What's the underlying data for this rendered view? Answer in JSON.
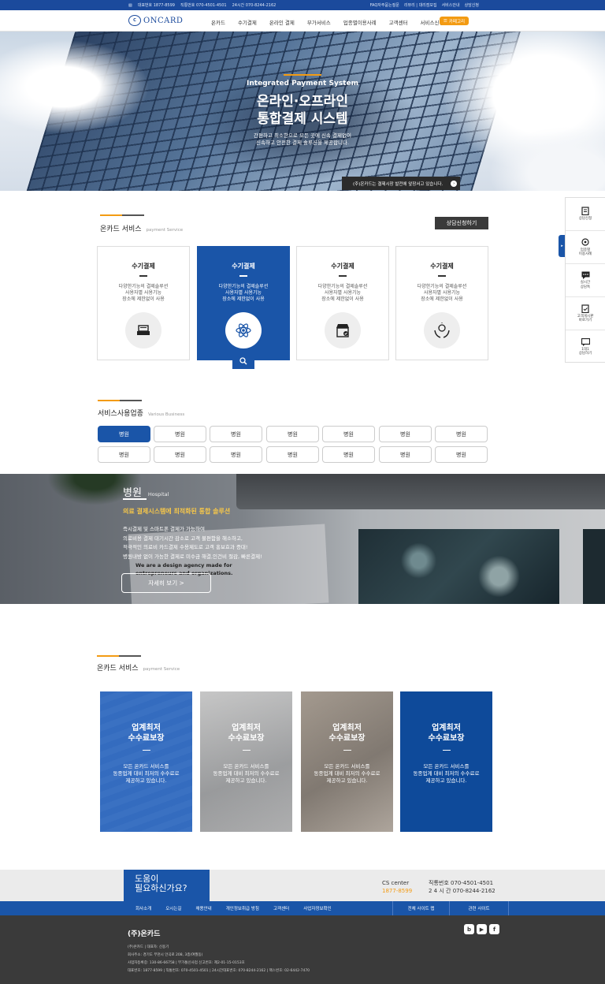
{
  "topbar": {
    "rep_phone": "대표번호 1877-8599",
    "direct_phone": "직통번호 070-4501-4501",
    "hours_phone": "24시간 070-8244-2162",
    "links": [
      "FAQ자주묻는질문",
      "리뷰리 | 대리점모집",
      "서비스안내",
      "상담신청"
    ]
  },
  "header": {
    "logo_text": "ONCARD",
    "nav": [
      "온카드",
      "수기결제",
      "온라인 결제",
      "부가서비스",
      "업종별이용사례",
      "고객센터",
      "서비스신청"
    ],
    "cafe_label": "카페고리"
  },
  "hero": {
    "subtitle": "Integrated Payment System",
    "title_line1": "온라인·오프라인",
    "title_line2": "통합결제 시스템",
    "desc_line1": "간편하고 최소한으로 모든 곳에 신속 결제없이",
    "desc_line2": "신속하고 안전한 결제 솔루션을 제공합니다.",
    "notice": "(주)온카드는 결제시장 발전에 앞장서고 있습니다."
  },
  "service": {
    "title": "온카드 서비스",
    "title_en": "payment Service",
    "consult_button": "상담신청하기",
    "cards": [
      {
        "title": "수기결제",
        "lines": [
          "다양한기능의 결제솔루션",
          "사용자별 사용기능",
          "장소에 제한없이 사용"
        ],
        "icon": "card-terminal-icon"
      },
      {
        "title": "수기결제",
        "lines": [
          "다양한기능의 결제솔루션",
          "사용자별 사용기능",
          "장소에 제한없이 사용"
        ],
        "icon": "atom-icon"
      },
      {
        "title": "수기결제",
        "lines": [
          "다양한기능의 결제솔루션",
          "사용자별 사용기능",
          "장소에 제한없이 사용"
        ],
        "icon": "store-icon"
      },
      {
        "title": "수기결제",
        "lines": [
          "다양한기능의 결제솔루션",
          "사용자별 사용기능",
          "장소에 제한없이 사용"
        ],
        "icon": "hands-idea-icon"
      }
    ]
  },
  "side_menu": {
    "items": [
      {
        "label1": "상담신청",
        "label2": ""
      },
      {
        "label1": "업종별",
        "label2": "이용사례"
      },
      {
        "label1": "실시간",
        "label2": "상담톡"
      },
      {
        "label1": "고객게시판",
        "label2": "바로가기"
      },
      {
        "label1": "1대1",
        "label2": "상담하기"
      }
    ]
  },
  "business": {
    "title": "서비스사용업종",
    "title_en": "Various Business",
    "row1": [
      "병원",
      "병원",
      "병원",
      "병원",
      "병원",
      "병원",
      "병원"
    ],
    "row2": [
      "병원",
      "병원",
      "병원",
      "병원",
      "병원",
      "병원",
      "병원"
    ]
  },
  "banner": {
    "title": "병원",
    "title_en": "Hospital",
    "subtitle": "의료 결제시스템에 최적화된 통합 솔루션",
    "lines": [
      "즉시결제 및 스마트폰 결제가 가능하여",
      "의료비용 결제 대기시간 감소로 고객 불편함을 해소하고,",
      "적극적인 의료비 카드결제 수용제도로 고객 홍보효과 증대!",
      "병원내방 없이 가능한 결제로 미수금 해결,인건비 절감, 빠른결제!"
    ],
    "ghost_line1": "We are a design agency made for",
    "ghost_line2": "entrepreneurs and organizations.",
    "more_button": "자세히 보기 >"
  },
  "fee": {
    "title": "온카드 서비스",
    "title_en": "payment Service",
    "cards": [
      {
        "t1": "업계최저",
        "t2": "수수료보장",
        "d1": "모든 온카드 서비스를",
        "d2": "동종업계 대비 최저의 수수료로",
        "d3": "제공하고 있습니다."
      },
      {
        "t1": "업계최저",
        "t2": "수수료보장",
        "d1": "모든 온카드 서비스를",
        "d2": "동종업계 대비 최저의 수수료로",
        "d3": "제공하고 있습니다."
      },
      {
        "t1": "업계최저",
        "t2": "수수료보장",
        "d1": "모든 온카드 서비스를",
        "d2": "동종업계 대비 최저의 수수료로",
        "d3": "제공하고 있습니다."
      },
      {
        "t1": "업계최저",
        "t2": "수수료보장",
        "d1": "모든 온카드 서비스를",
        "d2": "동종업계 대비 최저의 수수료로",
        "d3": "제공하고 있습니다."
      }
    ]
  },
  "help": {
    "line1": "도움이",
    "line2": "필요하신가요?",
    "cs_label": "CS center",
    "cs_number": "1877-8599",
    "direct": "직통번호 070-4501-4501",
    "hours": "2 4 시 간 070-8244-2162"
  },
  "footer_nav": {
    "links": [
      "회사소개",
      "오시는길",
      "채용안내",
      "개인정보취급 방침",
      "고객센터",
      "사업자정보확인"
    ],
    "site_map": "전체 사이트 맵",
    "related": "관련 사이트"
  },
  "footer": {
    "logo": "(주)온카드",
    "line1": "(주)온카드  |  대표자: 신용기",
    "line2": "회사주소: 경기도 부천시 안곡로 208, 3층(여월동)",
    "line3": "사업자등록증: 130-86-66758 | 부가통신사업 신고번호: 제2-01-15-0153호",
    "line4": "대표번호: 1877-8599 | 직통번호: 070-4501-4501 | 24시간대표번호: 070-8244-2162 | 팩스번호: 02-6442-7470",
    "sns": [
      "b",
      "▶",
      "f"
    ]
  }
}
